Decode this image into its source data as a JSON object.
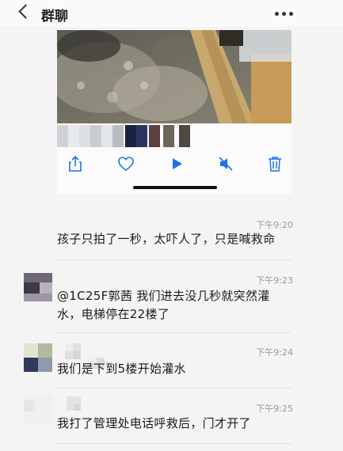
{
  "header": {
    "title": "群聊",
    "back_icon": "chevron-left-icon",
    "more_icon": "more-dots-icon"
  },
  "video_player": {
    "controls": [
      "share-icon",
      "heart-icon",
      "play-icon",
      "mute-icon",
      "trash-icon"
    ],
    "accent_color": "#1a73e8"
  },
  "messages": [
    {
      "time": "下午9:20",
      "lines": [
        "孩子只拍了一秒，太吓人了，只是喊救命"
      ]
    },
    {
      "time": "下午9:23",
      "lines": [
        "@1C25F郭茜 我们进去没几秒就突然灌",
        "水，电梯停在22楼了"
      ]
    },
    {
      "time": "下午9:24",
      "lines": [
        "我们是下到5楼开始灌水"
      ]
    },
    {
      "time": "下午9:25",
      "lines": [
        "我打了管理处电话呼救后，门才开了"
      ]
    }
  ]
}
